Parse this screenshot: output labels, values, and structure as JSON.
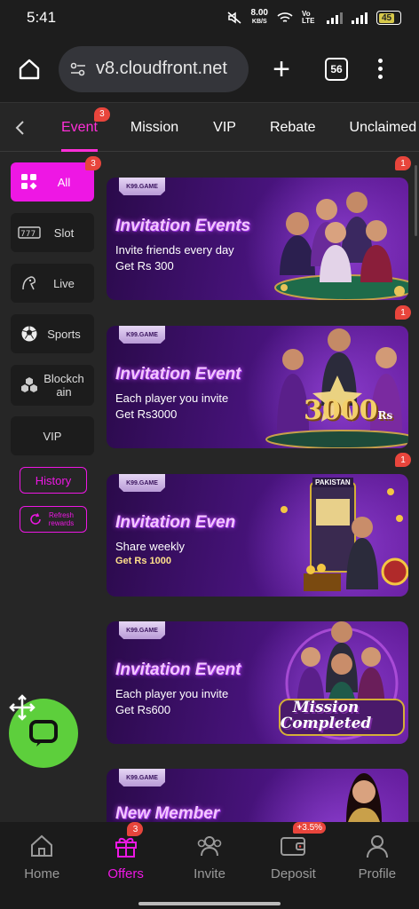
{
  "status": {
    "time": "5:41",
    "speed_value": "8.00",
    "speed_unit": "KB/S",
    "net": "Vo LTE",
    "battery": "45"
  },
  "browser": {
    "url": "v8.cloudfront.net",
    "tab_count": "56"
  },
  "category_tabs": [
    {
      "label": "Event",
      "badge": "3"
    },
    {
      "label": "Mission"
    },
    {
      "label": "VIP"
    },
    {
      "label": "Rebate"
    },
    {
      "label": "Unclaimed"
    }
  ],
  "sidebar": {
    "items": [
      {
        "label": "All",
        "badge": "3",
        "icon": "grid-icon"
      },
      {
        "label": "Slot",
        "icon": "slot-icon"
      },
      {
        "label": "Live",
        "icon": "live-icon"
      },
      {
        "label": "Sports",
        "icon": "soccer-ball-icon"
      },
      {
        "label": "Blockchain",
        "icon": "blockchain-icon"
      },
      {
        "label": "VIP"
      }
    ],
    "history_label": "History",
    "refresh_label": "Refresh rewards"
  },
  "banners": [
    {
      "brand": "K99.GAME",
      "title": "Invitation Events",
      "line1": "Invite friends every day",
      "line2": "Get Rs 300",
      "badge": "1"
    },
    {
      "brand": "K99.GAME",
      "title": "Invitation Event",
      "line1": "Each player you invite",
      "line2": "Get Rs3000",
      "badge": "1",
      "art_text": "3000",
      "art_unit": "Rs"
    },
    {
      "brand": "K99.GAME",
      "title": "Invitation Even",
      "line1": "Share weekly",
      "line2": "Get Rs 1000",
      "badge": "1",
      "art_text": "PAKISTAN"
    },
    {
      "brand": "K99.GAME",
      "title": "Invitation Event",
      "line1": "Each player you invite",
      "line2": "Get Rs600",
      "art_text": "Mission Completed"
    },
    {
      "brand": "K99.GAME",
      "title": "New Member"
    }
  ],
  "bottom_nav": [
    {
      "label": "Home",
      "icon": "home-icon"
    },
    {
      "label": "Offers",
      "icon": "gift-icon",
      "badge": "3"
    },
    {
      "label": "Invite",
      "icon": "users-icon"
    },
    {
      "label": "Deposit",
      "icon": "wallet-icon",
      "badge": "+3.5%"
    },
    {
      "label": "Profile",
      "icon": "person-icon"
    }
  ],
  "colors": {
    "accent": "#ee17e4",
    "badge": "#e8453c",
    "chat": "#5dcf3c"
  }
}
